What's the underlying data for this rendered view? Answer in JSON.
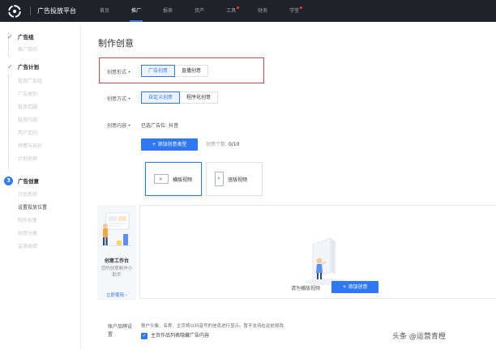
{
  "brand": {
    "name": "广告投放平台"
  },
  "nav": [
    {
      "label": "首页",
      "active": false,
      "dot": false
    },
    {
      "label": "推广",
      "active": true,
      "dot": false
    },
    {
      "label": "报表",
      "active": false,
      "dot": false
    },
    {
      "label": "资产",
      "active": false,
      "dot": false
    },
    {
      "label": "工具",
      "active": false,
      "dot": true
    },
    {
      "label": "财务",
      "active": false,
      "dot": false
    },
    {
      "label": "学堂",
      "active": false,
      "dot": true
    }
  ],
  "sidebar": {
    "group": "广告组",
    "group_sub": "推广目的",
    "plan": "广告计划",
    "plan_items": [
      "投放广告组",
      "广告类别",
      "投放范围",
      "投放内容",
      "用户定向",
      "预算与出价",
      "计划名称"
    ],
    "step_number": "3",
    "creative": "广告创意",
    "creative_items": [
      "计划名称",
      "设置投放位置",
      "制作创意",
      "创意分类",
      "监测链接"
    ]
  },
  "page": {
    "title": "制作创意"
  },
  "form": {
    "creative_form": {
      "label": "创意形式",
      "options": [
        "广告创意",
        "直播创意"
      ],
      "selected": 0
    },
    "creative_method": {
      "label": "创意方式",
      "options": [
        "自定义创意",
        "程序化创意"
      ],
      "selected": 0
    },
    "creative_content": {
      "label": "创意内容",
      "selected_text": "已选广告位:",
      "selected_value": "抖音"
    },
    "add_type_button": "+ 添加创意类型",
    "count_label": "创意个数:",
    "count_value": "0/10",
    "types": [
      "横版视频",
      "竖版视频"
    ],
    "studio": {
      "title": "创意工作台",
      "desc": "您的创意制作小助手",
      "link": "立即使用 ›"
    },
    "hint": "请为横版视频",
    "add_creative_button": "+ 添加创意",
    "brand_settings": {
      "label": "账户品牌设置",
      "desc": "账户头像、名称、主页将以抖音号的信息进行显示。暂不支持在此处修改",
      "checkbox": "主页作品列表隐藏广告内容",
      "checked": true
    }
  },
  "watermark": "头条 @运营青橙",
  "colors": {
    "accent": "#2f78f5",
    "topbar": "#1f2229",
    "highlight_box": "#e8414a"
  }
}
